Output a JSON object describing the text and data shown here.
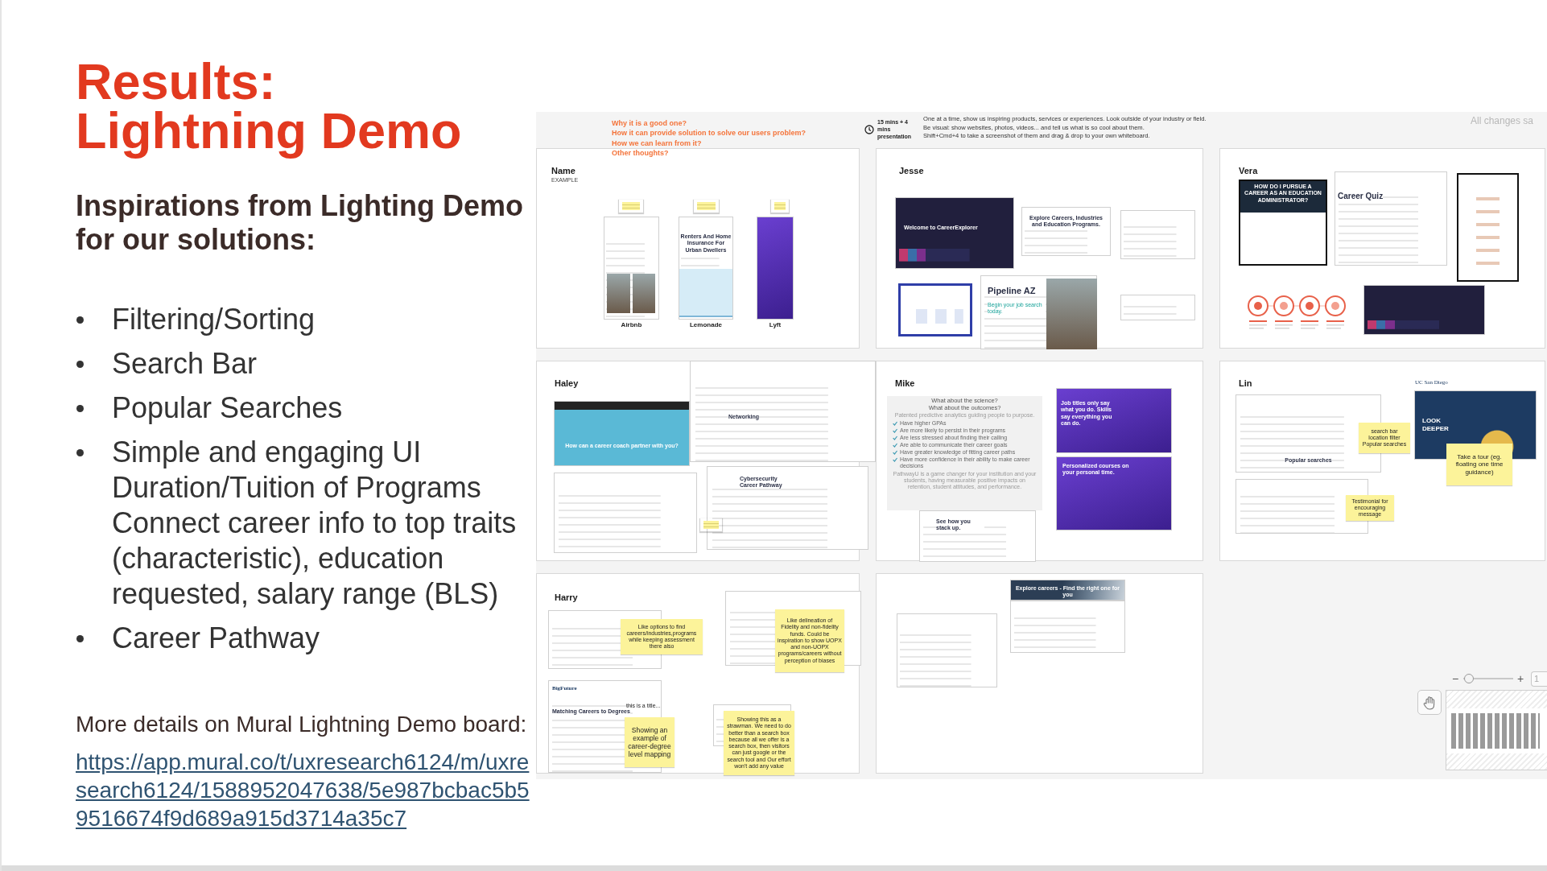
{
  "slide": {
    "title": [
      "Results:",
      "Lightning Demo"
    ],
    "subtitle": "Inspirations from Lighting Demo for our solutions:",
    "bullets": [
      {
        "lines": [
          "Filtering/Sorting"
        ]
      },
      {
        "lines": [
          "Search Bar"
        ]
      },
      {
        "lines": [
          "Popular Searches"
        ]
      },
      {
        "lines": [
          "Simple and engaging UI",
          "Duration/Tuition of Programs",
          "Connect career info to top traits (characteristic), education requested, salary range (BLS)"
        ]
      },
      {
        "lines": [
          "Career Pathway"
        ]
      }
    ],
    "details": "More details on Mural Lightning Demo board:",
    "link": "https://app.mural.co/t/uxresearch6124/m/uxresearch6124/1588952047638/5e987bcbac5b59516674f9d689a915d3714a35c7"
  },
  "board": {
    "prompts": [
      "Why it is a good one?",
      "How it can provide solution to solve our users problem?",
      "How we can learn from it?",
      "Other thoughts?"
    ],
    "timer": "15 mins + 4 mins presentation",
    "instructions": [
      "One at a time, show us inspiring products, services or experiences. Look outside of your industry or field.",
      "Be visual: show websites, photos, videos... and tell us what is so cool about them.",
      "Shift+Cmd+4 to take a screenshot of them and drag & drop to your own whiteboard."
    ],
    "save_status": "All changes sa",
    "panels": [
      {
        "name": "Name",
        "note": "EXAMPLE",
        "items": [
          {
            "kind": "light"
          },
          {
            "kind": "photo"
          },
          {
            "kind": "photo"
          },
          {
            "kind": "light",
            "title": "Renters And Home Insurance For Urban Dwellers"
          },
          {
            "kind": "art"
          },
          {
            "kind": "purple"
          },
          {
            "kind": "sticky"
          },
          {
            "kind": "sticky"
          },
          {
            "kind": "sticky"
          },
          {
            "kind": "caption",
            "text": "Airbnb"
          },
          {
            "kind": "caption",
            "text": "Lemonade"
          },
          {
            "kind": "caption",
            "text": "Lyft"
          }
        ]
      },
      {
        "name": "Jesse",
        "items": [
          {
            "kind": "dark",
            "title": "Welcome to CareerExplorer"
          },
          {
            "kind": "light",
            "title": "Explore Careers, Industries and Education Programs."
          },
          {
            "kind": "light"
          },
          {
            "kind": "framed"
          },
          {
            "kind": "light",
            "title": "Pipeline AZ",
            "lines": [
              "Begin your job search today."
            ]
          },
          {
            "kind": "photo"
          },
          {
            "kind": "light"
          }
        ]
      },
      {
        "name": "Vera",
        "items": [
          {
            "kind": "infographic",
            "title": "HOW DO I PURSUE A CAREER AS AN EDUCATION ADMINISTRATOR?"
          },
          {
            "kind": "light",
            "title": "Career Quiz"
          },
          {
            "kind": "boxed"
          },
          {
            "kind": "circles"
          },
          {
            "kind": "dark"
          }
        ]
      },
      {
        "name": "Haley",
        "items": [
          {
            "kind": "teal",
            "title": "How can a career coach partner with you?"
          },
          {
            "kind": "light",
            "title": "Networking"
          },
          {
            "kind": "light"
          },
          {
            "kind": "light",
            "title": "Cybersecurity Career Pathway"
          },
          {
            "kind": "sticky"
          }
        ]
      },
      {
        "name": "Mike",
        "items": [
          {
            "kind": "article",
            "headings": [
              "What about the science?",
              "What about the outcomes?"
            ],
            "lead": "Patented predictive analytics guiding people to purpose.",
            "checks": [
              "Have higher GPAs",
              "Are more likely to persist in their programs",
              "Are less stressed about finding their calling",
              "Are able to communicate their career goals",
              "Have greater knowledge of fitting career paths",
              "Have more confidence in their ability to make career decisions"
            ],
            "footer": "PathwayU is a game changer for your institution and your students, having measurable positive impacts on retention, student attitudes, and performance."
          },
          {
            "kind": "light",
            "title": "See how you stack up."
          },
          {
            "kind": "purple",
            "title": "Job titles only say what you do. Skills say everything you can do."
          },
          {
            "kind": "purple",
            "title": "Personalized courses on your personal time."
          }
        ]
      },
      {
        "name": "Lin",
        "items": [
          {
            "kind": "light",
            "title": "Popular searches"
          },
          {
            "kind": "sticky",
            "text": "search bar location filter Popular searches"
          },
          {
            "kind": "logo",
            "text": "UC San Diego"
          },
          {
            "kind": "navy",
            "title": "LOOK DEEPER"
          },
          {
            "kind": "sticky",
            "text": "Take a tour (eg. floating one time guidance)"
          },
          {
            "kind": "light"
          },
          {
            "kind": "sticky",
            "text": "Testimonial for encouraging message"
          }
        ]
      },
      {
        "name": "Harry",
        "items": [
          {
            "kind": "light"
          },
          {
            "kind": "sticky",
            "text": "Like options to find careers/industries,programs while keeping assessment there also"
          },
          {
            "kind": "light"
          },
          {
            "kind": "sticky",
            "text": "Like delineation of Fidelity and non-fidelity funds. Could be inspiration to show UOPX and non-UOPX programs/careers without perception of biases"
          },
          {
            "kind": "light",
            "brand": "BigFuture",
            "title": "Matching Careers to Degrees"
          },
          {
            "kind": "label",
            "text": "this is a title..."
          },
          {
            "kind": "sticky",
            "text": "Showing an example of career-degree level mapping"
          },
          {
            "kind": "light"
          },
          {
            "kind": "sticky",
            "text": "Showing this as a strawman. We need to do better than a search box because all we offer is a search box, then visitors can just google or the search tool and Our effort won't add any value"
          }
        ]
      },
      {
        "items": [
          {
            "kind": "banner",
            "title": "Explore careers - Find the right one for you"
          },
          {
            "kind": "light"
          },
          {
            "kind": "light"
          }
        ]
      }
    ],
    "zoom": {
      "zoom_out": "−",
      "level": 0.12,
      "zoom_in": "+",
      "percent": "1"
    }
  }
}
